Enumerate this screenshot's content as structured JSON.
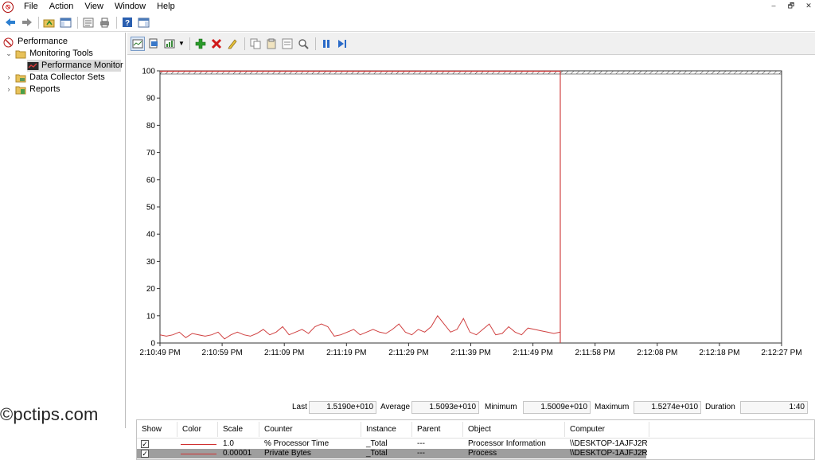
{
  "menubar": {
    "items": [
      "File",
      "Action",
      "View",
      "Window",
      "Help"
    ],
    "window_controls": [
      "–",
      "🗗",
      "✕"
    ]
  },
  "toolbar": {
    "icons": [
      "back-arrow-icon",
      "forward-arrow-icon",
      "up-folder-icon",
      "show-hide-console-tree-icon",
      "properties-icon",
      "print-icon",
      "help-icon",
      "show-action-pane-icon"
    ]
  },
  "tree": {
    "root": "Performance",
    "monitoring_tools": "Monitoring Tools",
    "performance_monitor": "Performance Monitor",
    "data_collector_sets": "Data Collector Sets",
    "reports": "Reports"
  },
  "graph_toolbar": {
    "icons": [
      "view-current-activity-icon",
      "view-log-data-icon",
      "change-graph-type-icon",
      "add-counter-icon",
      "delete-counter-icon",
      "highlight-icon",
      "copy-properties-icon",
      "paste-counter-list-icon",
      "properties-icon",
      "zoom-icon",
      "freeze-display-icon",
      "update-data-icon"
    ]
  },
  "chart_data": {
    "type": "line",
    "ylim": [
      0,
      100
    ],
    "yticks": [
      "0",
      "10",
      "20",
      "30",
      "40",
      "50",
      "60",
      "70",
      "80",
      "90",
      "100"
    ],
    "xticks": [
      "2:10:49 PM",
      "2:10:59 PM",
      "2:11:09 PM",
      "2:11:19 PM",
      "2:11:29 PM",
      "2:11:39 PM",
      "2:11:49 PM",
      "2:11:58 PM",
      "2:12:08 PM",
      "2:12:18 PM",
      "2:12:27 PM"
    ],
    "grid": false,
    "current_time_marker": "2:11:53 PM",
    "series": [
      {
        "color": "#d04040",
        "values": [
          3,
          2.5,
          3,
          4,
          2,
          3.5,
          3,
          2.5,
          3,
          4,
          1.5,
          3,
          4,
          3,
          2.5,
          3.5,
          5,
          3,
          4,
          6,
          3,
          4,
          5,
          3.5,
          6,
          7,
          6,
          2.5,
          3,
          4,
          5,
          3,
          4,
          5,
          4,
          3.5,
          5,
          7,
          4,
          3,
          5,
          4,
          6,
          10,
          7,
          4,
          5,
          9,
          4,
          3,
          5,
          7,
          3,
          3.5,
          6,
          4,
          3,
          5.5,
          5,
          4.5,
          4,
          3.5,
          4
        ],
        "flat_value": 100
      }
    ]
  },
  "stats": {
    "last_label": "Last",
    "last_value": "1.5190e+010",
    "average_label": "Average",
    "average_value": "1.5093e+010",
    "minimum_label": "Minimum",
    "minimum_value": "1.5009e+010",
    "maximum_label": "Maximum",
    "maximum_value": "1.5274e+010",
    "duration_label": "Duration",
    "duration_value": "1:40"
  },
  "counters": {
    "headers": [
      "Show",
      "Color",
      "Scale",
      "Counter",
      "Instance",
      "Parent",
      "Object",
      "Computer"
    ],
    "rows": [
      {
        "scale": "1.0",
        "counter": "% Processor Time",
        "instance": "_Total",
        "parent": "---",
        "object": "Processor Information",
        "computer": "\\\\DESKTOP-1AJFJ2R",
        "color": "#d03030"
      },
      {
        "scale": "0.00001",
        "counter": "Private Bytes",
        "instance": "_Total",
        "parent": "---",
        "object": "Process",
        "computer": "\\\\DESKTOP-1AJFJ2R",
        "color": "#d03030"
      }
    ]
  },
  "watermark": "©pctips.com"
}
